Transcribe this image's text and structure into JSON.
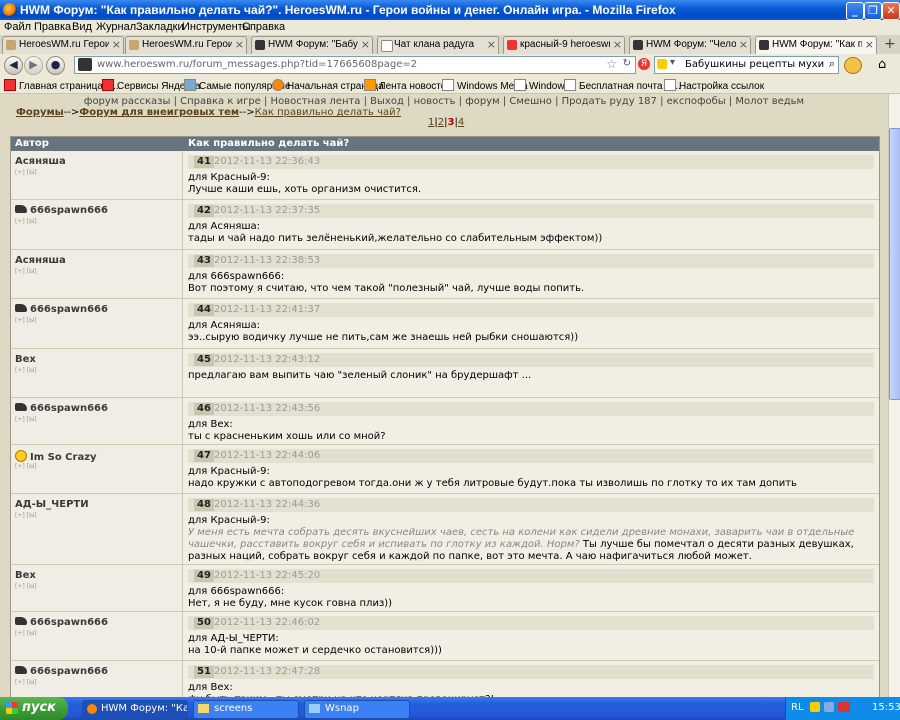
{
  "window": {
    "title": "HWM Форум: \"Как правильно делать чай?\". HeroesWM.ru - Герои войны и денег. Онлайн игра. - Mozilla Firefox"
  },
  "menu": [
    "Файл",
    "Правка",
    "Вид",
    "Журнал",
    "Закладки",
    "Инструменты",
    "Справка"
  ],
  "tabs": [
    {
      "label": "HeroesWM.ru Герои войн..."
    },
    {
      "label": "HeroesWM.ru Герои войн..."
    },
    {
      "label": "HWM Форум: \"Бабушкин..."
    },
    {
      "label": "Чат клана радуга"
    },
    {
      "label": "красный-9 heroeswm.ru-..."
    },
    {
      "label": "HWM Форум: \"Человек и..."
    },
    {
      "label": "HWM Форум: \"Как прави..."
    }
  ],
  "nav": {
    "url": "www.heroeswm.ru/forum_messages.php?tid=17665608page=2",
    "search": "Бабушкины рецепты мухи"
  },
  "bookmarks": [
    "Главная страница Я...",
    "Сервисы Яндекса",
    "Самые популярные",
    "Начальная страница",
    "Лента новостей",
    "Windows Media",
    "Windows",
    "Бесплатная почта H...",
    "Настройка ссылок"
  ],
  "page": {
    "topnav": "форум рассказы | Справка к игре | Новостная лента | Выход | новость | форум | Смешно | Продать руду 187 | експофобы | Молот ведьм",
    "breadcrumb": {
      "a": "Форумы",
      "sep1": "-->",
      "b": "Форум для внеигровых тем",
      "sep2": "-->",
      "c": "Как правильно делать чай?"
    },
    "pages": {
      "p1": "1",
      "p2": "2",
      "p3": "3",
      "p4": "4"
    },
    "header": {
      "author": "Автор",
      "topic": "Как правильно делать чай?"
    }
  },
  "posts": [
    {
      "author": "Асяняша",
      "num": "41",
      "date": "2012-11-13 22:36:43",
      "to": "для Красный-9:",
      "text": "Лучше каши ешь, хоть организм очистится."
    },
    {
      "author": "666spawn666",
      "num": "42",
      "date": "2012-11-13 22:37:35",
      "to": "для Асяняша:",
      "text": "тады и чай надо пить зелёненький,желательно со слабительным эффектом))"
    },
    {
      "author": "Асяняша",
      "num": "43",
      "date": "2012-11-13 22:38:53",
      "to": "для 666spawn666:",
      "text": "Вот поэтому я считаю, что чем такой \"полезный\" чай, лучше воды попить."
    },
    {
      "author": "666spawn666",
      "num": "44",
      "date": "2012-11-13 22:41:37",
      "to": "для Асяняша:",
      "text": "ээ..сырую водичку лучше не пить,сам же знаешь ней рыбки сношаются))"
    },
    {
      "author": "Вех",
      "num": "45",
      "date": "2012-11-13 22:43:12",
      "to": "",
      "text": "предлагаю вам выпить чаю \"зеленый слоник\" на брудершафт ..."
    },
    {
      "author": "666spawn666",
      "num": "46",
      "date": "2012-11-13 22:43:56",
      "to": "для Вех:",
      "text": "ты с красненьким хошь или со мной?"
    },
    {
      "author": "Im So Crazy",
      "num": "47",
      "date": "2012-11-13 22:44:06",
      "to": "для Красный-9:",
      "text": "надо кружки с автоподогревом тогда.они ж у тебя литровые будут.пока ты изволишь по глотку то их там допить"
    },
    {
      "author": "АД-Ы_ЧЕРТИ",
      "num": "48",
      "date": "2012-11-13 22:44:36",
      "to": "для Красный-9:",
      "quote": "У меня есть мечта собрать десять вкуснейших чаев, сесть на колени как сидели древние монахи, заварить чаи в отдельные чашечки, расставить вокруг себя и испивать по глотку из каждой. Норм?",
      "text": " Ты лучше бы помечтал о десяти разных девушках, разных наций, собрать вокруг себя и каждой по папке, вот это мечта. А чаю нафигачиться любой может."
    },
    {
      "author": "Вех",
      "num": "49",
      "date": "2012-11-13 22:45:20",
      "to": "для 666spawn666:",
      "text": "Нет, я не буду, мне кусок говна плиз))"
    },
    {
      "author": "666spawn666",
      "num": "50",
      "date": "2012-11-13 22:46:02",
      "to": "для АД-Ы_ЧЕРТИ:",
      "text": "на 10-й папке может и сердечко остановится)))"
    },
    {
      "author": "666spawn666",
      "num": "51",
      "date": "2012-11-13 22:47:28",
      "to": "для Вех:",
      "text": "фу быть таким...ты смотри на что чертяка провоцирует?!"
    }
  ],
  "taskbar": {
    "start": "пуск",
    "items": [
      "HWM Форум: \"Как п...",
      "screens",
      "Wsnap"
    ],
    "lang": "RL",
    "time": "15:53"
  }
}
